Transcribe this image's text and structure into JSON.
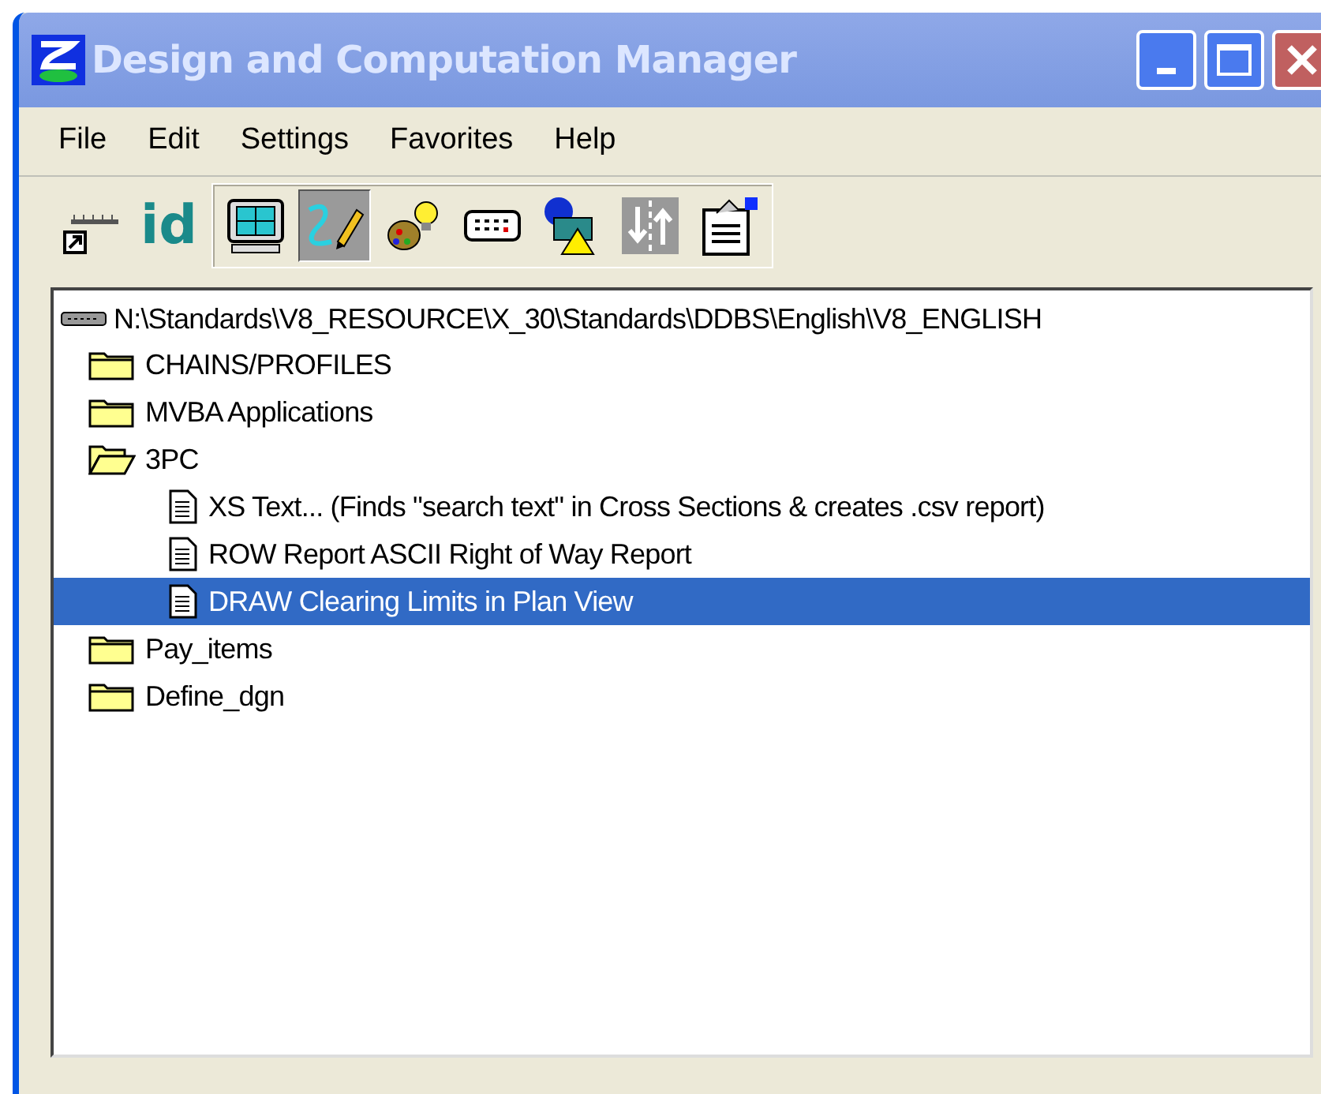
{
  "window": {
    "title": "Design and Computation Manager"
  },
  "menu": [
    "File",
    "Edit",
    "Settings",
    "Favorites",
    "Help"
  ],
  "toolbar": [
    {
      "kind": "ruler",
      "pressed": false
    },
    {
      "kind": "id",
      "label": "id",
      "pressed": false
    },
    {
      "kind": "monitor",
      "pressed": false
    },
    {
      "kind": "pen",
      "pressed": true
    },
    {
      "kind": "palette",
      "pressed": false
    },
    {
      "kind": "keypad",
      "pressed": false
    },
    {
      "kind": "shapes",
      "pressed": false
    },
    {
      "kind": "arrows",
      "pressed": false
    },
    {
      "kind": "clipboard",
      "pressed": false
    }
  ],
  "tree": {
    "root": "N:\\Standards\\V8_RESOURCE\\X_30\\Standards\\DDBS\\English\\V8_ENGLISH",
    "children": [
      {
        "kind": "folder",
        "label": "CHAINS/PROFILES",
        "expanded": false,
        "selected": false
      },
      {
        "kind": "folder",
        "label": "MVBA Applications",
        "expanded": false,
        "selected": false
      },
      {
        "kind": "folder",
        "label": "3PC",
        "expanded": true,
        "selected": false,
        "children": [
          {
            "kind": "file",
            "label": "XS Text... (Finds \"search text\" in Cross Sections & creates .csv report)",
            "selected": false
          },
          {
            "kind": "file",
            "label": "ROW Report ASCII Right of Way Report",
            "selected": false
          },
          {
            "kind": "file",
            "label": "DRAW Clearing Limits in Plan View",
            "selected": true
          }
        ]
      },
      {
        "kind": "folder",
        "label": "Pay_items",
        "expanded": false,
        "selected": false
      },
      {
        "kind": "folder",
        "label": "Define_dgn",
        "expanded": false,
        "selected": false
      }
    ]
  }
}
